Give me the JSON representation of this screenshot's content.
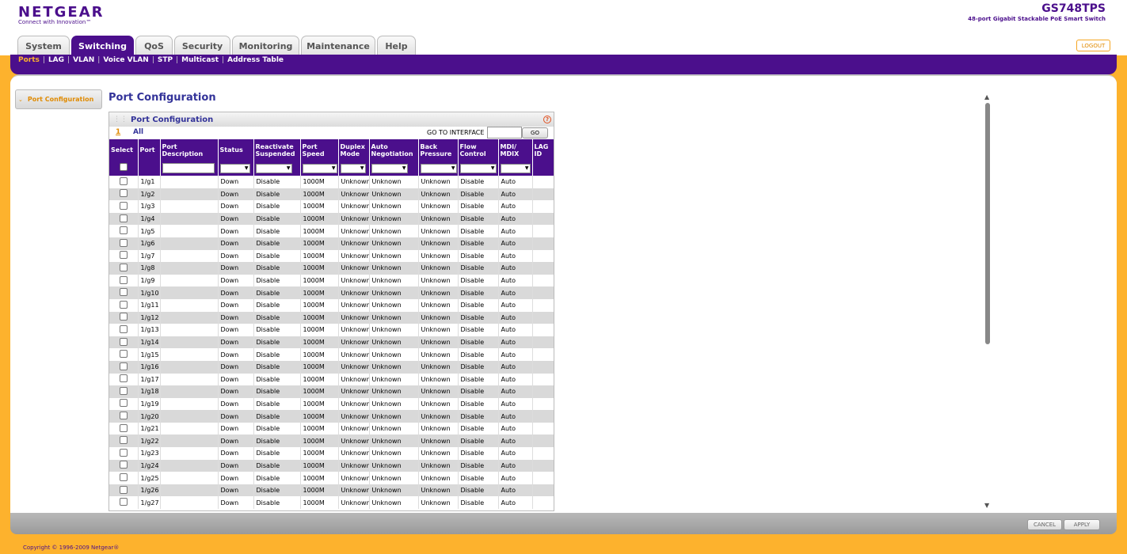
{
  "brand": {
    "logo": "NETGEAR",
    "tagline": "Connect with Innovation™",
    "model": "GS748TPS",
    "model_desc": "48-port Gigabit Stackable PoE Smart Switch"
  },
  "tabs": [
    "System",
    "Switching",
    "QoS",
    "Security",
    "Monitoring",
    "Maintenance",
    "Help"
  ],
  "logout_label": "LOGOUT",
  "subnav": [
    "Ports",
    "LAG",
    "VLAN",
    "Voice VLAN",
    "STP",
    "Multicast",
    "Address Table"
  ],
  "side_menu": {
    "item": "Port Configuration"
  },
  "page_title": "Port Configuration",
  "box": {
    "title": "Port Configuration",
    "help": "?",
    "page_number": "1",
    "all_label": "All",
    "goto_label": "GO TO INTERFACE",
    "goto_value": "",
    "go_label": "GO"
  },
  "columns": [
    [
      "Select"
    ],
    [
      "Port"
    ],
    [
      "Port",
      "Description"
    ],
    [
      "Status"
    ],
    [
      "Reactivate",
      "Suspended"
    ],
    [
      "Port",
      "Speed"
    ],
    [
      "Duplex",
      "Mode"
    ],
    [
      "Auto",
      "Negotiation"
    ],
    [
      "Back",
      "Pressure"
    ],
    [
      "Flow",
      "Control"
    ],
    [
      "MDI/",
      "MDIX"
    ],
    [
      "LAG",
      "ID"
    ]
  ],
  "rows": [
    [
      "1/g1",
      "",
      "Down",
      "Disable",
      "1000M",
      "Unknown",
      "Unknown",
      "Unknown",
      "Disable",
      "Auto",
      ""
    ],
    [
      "1/g2",
      "",
      "Down",
      "Disable",
      "1000M",
      "Unknown",
      "Unknown",
      "Unknown",
      "Disable",
      "Auto",
      ""
    ],
    [
      "1/g3",
      "",
      "Down",
      "Disable",
      "1000M",
      "Unknown",
      "Unknown",
      "Unknown",
      "Disable",
      "Auto",
      ""
    ],
    [
      "1/g4",
      "",
      "Down",
      "Disable",
      "1000M",
      "Unknown",
      "Unknown",
      "Unknown",
      "Disable",
      "Auto",
      ""
    ],
    [
      "1/g5",
      "",
      "Down",
      "Disable",
      "1000M",
      "Unknown",
      "Unknown",
      "Unknown",
      "Disable",
      "Auto",
      ""
    ],
    [
      "1/g6",
      "",
      "Down",
      "Disable",
      "1000M",
      "Unknown",
      "Unknown",
      "Unknown",
      "Disable",
      "Auto",
      ""
    ],
    [
      "1/g7",
      "",
      "Down",
      "Disable",
      "1000M",
      "Unknown",
      "Unknown",
      "Unknown",
      "Disable",
      "Auto",
      ""
    ],
    [
      "1/g8",
      "",
      "Down",
      "Disable",
      "1000M",
      "Unknown",
      "Unknown",
      "Unknown",
      "Disable",
      "Auto",
      ""
    ],
    [
      "1/g9",
      "",
      "Down",
      "Disable",
      "1000M",
      "Unknown",
      "Unknown",
      "Unknown",
      "Disable",
      "Auto",
      ""
    ],
    [
      "1/g10",
      "",
      "Down",
      "Disable",
      "1000M",
      "Unknown",
      "Unknown",
      "Unknown",
      "Disable",
      "Auto",
      ""
    ],
    [
      "1/g11",
      "",
      "Down",
      "Disable",
      "1000M",
      "Unknown",
      "Unknown",
      "Unknown",
      "Disable",
      "Auto",
      ""
    ],
    [
      "1/g12",
      "",
      "Down",
      "Disable",
      "1000M",
      "Unknown",
      "Unknown",
      "Unknown",
      "Disable",
      "Auto",
      ""
    ],
    [
      "1/g13",
      "",
      "Down",
      "Disable",
      "1000M",
      "Unknown",
      "Unknown",
      "Unknown",
      "Disable",
      "Auto",
      ""
    ],
    [
      "1/g14",
      "",
      "Down",
      "Disable",
      "1000M",
      "Unknown",
      "Unknown",
      "Unknown",
      "Disable",
      "Auto",
      ""
    ],
    [
      "1/g15",
      "",
      "Down",
      "Disable",
      "1000M",
      "Unknown",
      "Unknown",
      "Unknown",
      "Disable",
      "Auto",
      ""
    ],
    [
      "1/g16",
      "",
      "Down",
      "Disable",
      "1000M",
      "Unknown",
      "Unknown",
      "Unknown",
      "Disable",
      "Auto",
      ""
    ],
    [
      "1/g17",
      "",
      "Down",
      "Disable",
      "1000M",
      "Unknown",
      "Unknown",
      "Unknown",
      "Disable",
      "Auto",
      ""
    ],
    [
      "1/g18",
      "",
      "Down",
      "Disable",
      "1000M",
      "Unknown",
      "Unknown",
      "Unknown",
      "Disable",
      "Auto",
      ""
    ],
    [
      "1/g19",
      "",
      "Down",
      "Disable",
      "1000M",
      "Unknown",
      "Unknown",
      "Unknown",
      "Disable",
      "Auto",
      ""
    ],
    [
      "1/g20",
      "",
      "Down",
      "Disable",
      "1000M",
      "Unknown",
      "Unknown",
      "Unknown",
      "Disable",
      "Auto",
      ""
    ],
    [
      "1/g21",
      "",
      "Down",
      "Disable",
      "1000M",
      "Unknown",
      "Unknown",
      "Unknown",
      "Disable",
      "Auto",
      ""
    ],
    [
      "1/g22",
      "",
      "Down",
      "Disable",
      "1000M",
      "Unknown",
      "Unknown",
      "Unknown",
      "Disable",
      "Auto",
      ""
    ],
    [
      "1/g23",
      "",
      "Down",
      "Disable",
      "1000M",
      "Unknown",
      "Unknown",
      "Unknown",
      "Disable",
      "Auto",
      ""
    ],
    [
      "1/g24",
      "",
      "Down",
      "Disable",
      "1000M",
      "Unknown",
      "Unknown",
      "Unknown",
      "Disable",
      "Auto",
      ""
    ],
    [
      "1/g25",
      "",
      "Down",
      "Disable",
      "1000M",
      "Unknown",
      "Unknown",
      "Unknown",
      "Disable",
      "Auto",
      ""
    ],
    [
      "1/g26",
      "",
      "Down",
      "Disable",
      "1000M",
      "Unknown",
      "Unknown",
      "Unknown",
      "Disable",
      "Auto",
      ""
    ],
    [
      "1/g27",
      "",
      "Down",
      "Disable",
      "1000M",
      "Unknown",
      "Unknown",
      "Unknown",
      "Disable",
      "Auto",
      ""
    ]
  ],
  "buttons": {
    "cancel": "CANCEL",
    "apply": "APPLY"
  },
  "copyright": "Copyright © 1996-2009 Netgear®",
  "colors": {
    "brand_purple": "#4B0F8C",
    "accent_orange": "#FDB22D",
    "link_orange": "#E08A00"
  }
}
